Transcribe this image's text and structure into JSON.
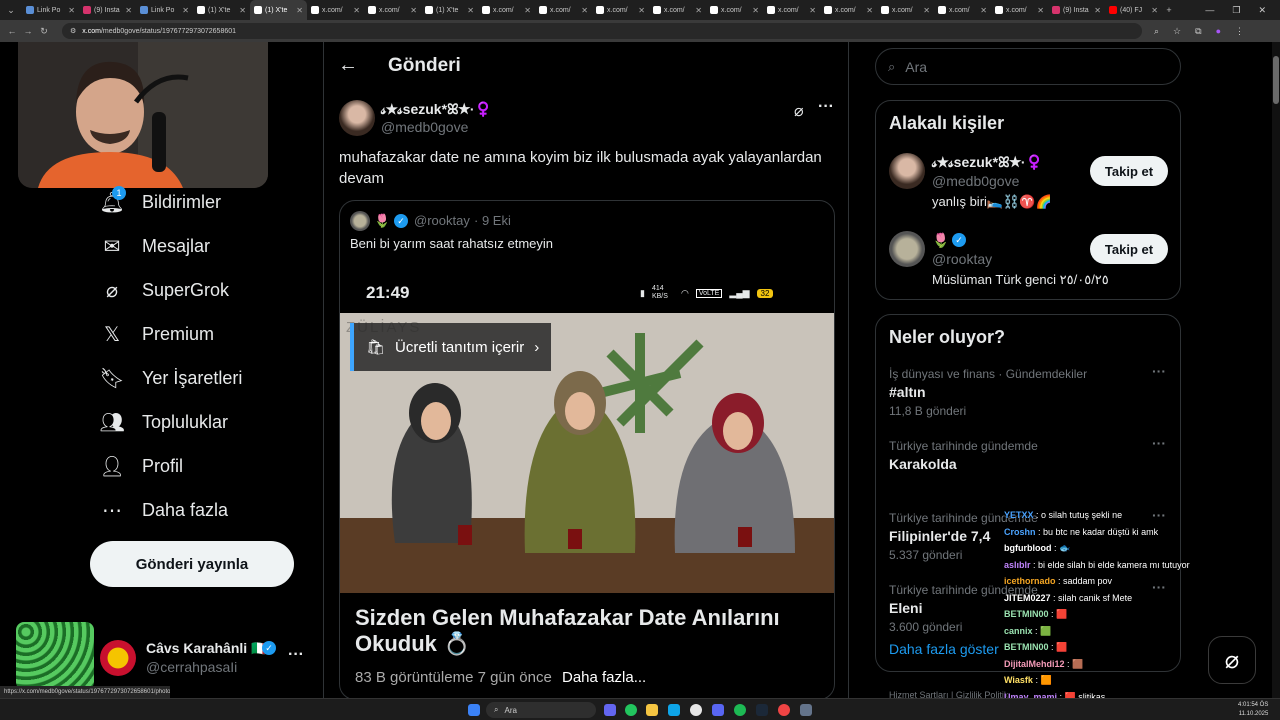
{
  "browser": {
    "tabs": [
      {
        "label": "Link Po",
        "color": "#5a8fd6"
      },
      {
        "label": "(9) Insta",
        "color": "#d6336c"
      },
      {
        "label": "Link Po",
        "color": "#5a8fd6"
      },
      {
        "label": "(1) X'te",
        "color": "#ffffff"
      },
      {
        "label": "(1) X'te",
        "color": "#ffffff",
        "active": true
      },
      {
        "label": "x.com/",
        "color": "#ffffff"
      },
      {
        "label": "x.com/",
        "color": "#ffffff"
      },
      {
        "label": "(1) X'te",
        "color": "#ffffff"
      },
      {
        "label": "x.com/",
        "color": "#ffffff"
      },
      {
        "label": "x.com/",
        "color": "#ffffff"
      },
      {
        "label": "x.com/",
        "color": "#ffffff"
      },
      {
        "label": "x.com/",
        "color": "#ffffff"
      },
      {
        "label": "x.com/",
        "color": "#ffffff"
      },
      {
        "label": "x.com/",
        "color": "#ffffff"
      },
      {
        "label": "x.com/",
        "color": "#ffffff"
      },
      {
        "label": "x.com/",
        "color": "#ffffff"
      },
      {
        "label": "x.com/",
        "color": "#ffffff"
      },
      {
        "label": "x.com/",
        "color": "#ffffff"
      },
      {
        "label": "(9) Insta",
        "color": "#d6336c"
      },
      {
        "label": "(40) FJ",
        "color": "#ff0000"
      }
    ],
    "url_domain": "x.com",
    "url_path": "/medb0gove/status/1976772973072658601"
  },
  "nav": {
    "items": [
      {
        "label": "Bildirimler",
        "icon": "bell-icon",
        "badge": "1"
      },
      {
        "label": "Mesajlar",
        "icon": "mail-icon"
      },
      {
        "label": "SuperGrok",
        "icon": "grok-icon"
      },
      {
        "label": "Premium",
        "icon": "x-logo-icon"
      },
      {
        "label": "Yer İşaretleri",
        "icon": "bookmark-icon"
      },
      {
        "label": "Topluluklar",
        "icon": "communities-icon"
      },
      {
        "label": "Profil",
        "icon": "profile-icon"
      },
      {
        "label": "Daha fazla",
        "icon": "more-circle-icon"
      }
    ],
    "post_button": "Gönderi yayınla",
    "account": {
      "name": "Câvs Karahânli 🇮🇹",
      "handle": "@cerrahpasaIi",
      "more": "···"
    }
  },
  "main": {
    "header_title": "Gönderi",
    "post": {
      "author_name": "𝓈★𝓈sezuk*ꕤ★·♀️",
      "author_handle": "@medb0gove",
      "text": "muhafazakar date ne amına koyim biz ilk bulusmada ayak yalayanlardan devam",
      "more": "···"
    },
    "quote": {
      "author_name": "🌷",
      "author_handle": "@rooktay",
      "date": "· 9 Eki",
      "text": "Beni bi yarım saat rahatsız etmeyin",
      "status_time": "21:49",
      "status_speed": "414 KB/S",
      "status_volte": "VoLTE",
      "status_battery": "32",
      "watermark": "ZÜLİAYS",
      "promo_label": "Ücretli tanıtım içerir",
      "video_title": "Sizden Gelen Muhafazakar Date Anılarını Okuduk 💍",
      "video_meta": "83 B görüntüleme  7 gün önce",
      "video_more": "Daha fazla..."
    }
  },
  "right": {
    "search_placeholder": "Ara",
    "related_title": "Alakalı kişiler",
    "related": [
      {
        "name": "𝓈★𝓈sezuk*ꕤ★·♀️",
        "handle": "@medb0gove",
        "bio": "yanlış biri🛌⛓️♈🌈",
        "button": "Takip et"
      },
      {
        "name": "🌷",
        "handle": "@rooktay",
        "bio": "Müslüman Türk genci ٢٥/٠٥/٢٥",
        "button": "Takip et"
      }
    ],
    "trends_title": "Neler oluyor?",
    "trends": [
      {
        "context": "İş dünyası ve finans · Gündemdekiler",
        "name": "#altın",
        "count": "11,8 B gönderi"
      },
      {
        "context": "Türkiye tarihinde gündemde",
        "name": "Karakolda",
        "count": ""
      },
      {
        "context": "Türkiye tarihinde gündemde",
        "name": "Filipinler'de 7,4",
        "count": "5.337 gönderi"
      },
      {
        "context": "Türkiye tarihinde gündemde",
        "name": "Eleni",
        "count": "3.600 gönderi"
      }
    ],
    "show_more": "Daha fazla göster",
    "footer": "Hizmet Şartları  |  Gizlilik Politikası  |  Çerez Politikası"
  },
  "chat": [
    {
      "user": "YETXX",
      "color": "#4aa3ff",
      "msg": "o silah tutuş şekli ne"
    },
    {
      "user": "Croshn",
      "color": "#4aa3ff",
      "msg": "bu btc ne kadar düştü ki amk"
    },
    {
      "user": "bgfurblood",
      "color": "#ffffff",
      "msg": "🐟"
    },
    {
      "user": "aslıblr",
      "color": "#c084fc",
      "msg": "bi elde silah bi elde kamera mı tutuyor"
    },
    {
      "user": "icethornado",
      "color": "#f5a623",
      "msg": "saddam pov"
    },
    {
      "user": "JITEM0227",
      "color": "#ffffff",
      "msg": "silah canik sf Mete"
    },
    {
      "user": "BETMIN00",
      "color": "#9be3b1",
      "msg": "🟥"
    },
    {
      "user": "cannix",
      "color": "#9be3b1",
      "msg": "🟩"
    },
    {
      "user": "BETMIN00",
      "color": "#9be3b1",
      "msg": "🟥"
    },
    {
      "user": "DijitalMehdi12",
      "color": "#f59bb8",
      "msg": "🟫"
    },
    {
      "user": "Wiasfk",
      "color": "#ffe066",
      "msg": "🟧"
    },
    {
      "user": "Umay_mami",
      "color": "#c084fc",
      "msg": "🟥 slitikas"
    }
  ],
  "status_url": "https://x.com/medb0gove/status/1976772973072658601/photo/1",
  "taskbar": {
    "search": "Ara",
    "time": "4:01:54 ÖS",
    "date": "11.10.2025"
  },
  "colors": {
    "accent": "#1d9bf0",
    "bg": "#000000",
    "border": "#2f3336",
    "muted": "#71767b"
  }
}
